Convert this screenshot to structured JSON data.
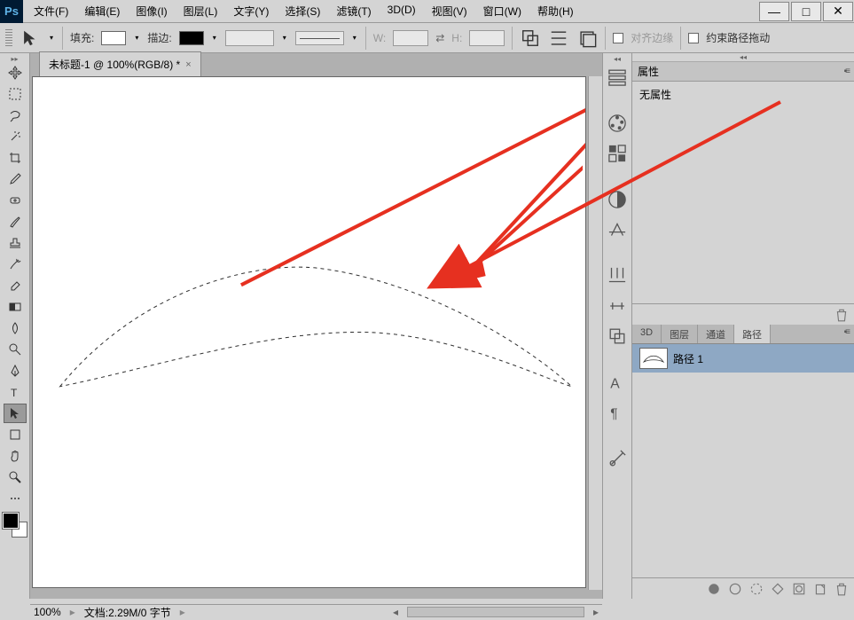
{
  "menubar": {
    "items": [
      {
        "label": "文件(F)"
      },
      {
        "label": "编辑(E)"
      },
      {
        "label": "图像(I)"
      },
      {
        "label": "图层(L)"
      },
      {
        "label": "文字(Y)"
      },
      {
        "label": "选择(S)"
      },
      {
        "label": "滤镜(T)"
      },
      {
        "label": "3D(D)"
      },
      {
        "label": "视图(V)"
      },
      {
        "label": "窗口(W)"
      },
      {
        "label": "帮助(H)"
      }
    ]
  },
  "optionsbar": {
    "fill_label": "填充:",
    "stroke_label": "描边:",
    "w_label": "W:",
    "h_label": "H:",
    "align_edges": "对齐边缘",
    "constrain_path": "约束路径拖动"
  },
  "document": {
    "tab_title": "未标题-1 @ 100%(RGB/8) *",
    "zoom": "100%",
    "doc_info": "文档:2.29M/0 字节"
  },
  "panels": {
    "properties_title": "属性",
    "no_properties": "无属性",
    "tabs": {
      "t3d": "3D",
      "layers": "图层",
      "channels": "通道",
      "paths": "路径"
    },
    "path_name": "路径 1"
  },
  "window_controls": {
    "min": "—",
    "max": "□",
    "close": "✕"
  }
}
